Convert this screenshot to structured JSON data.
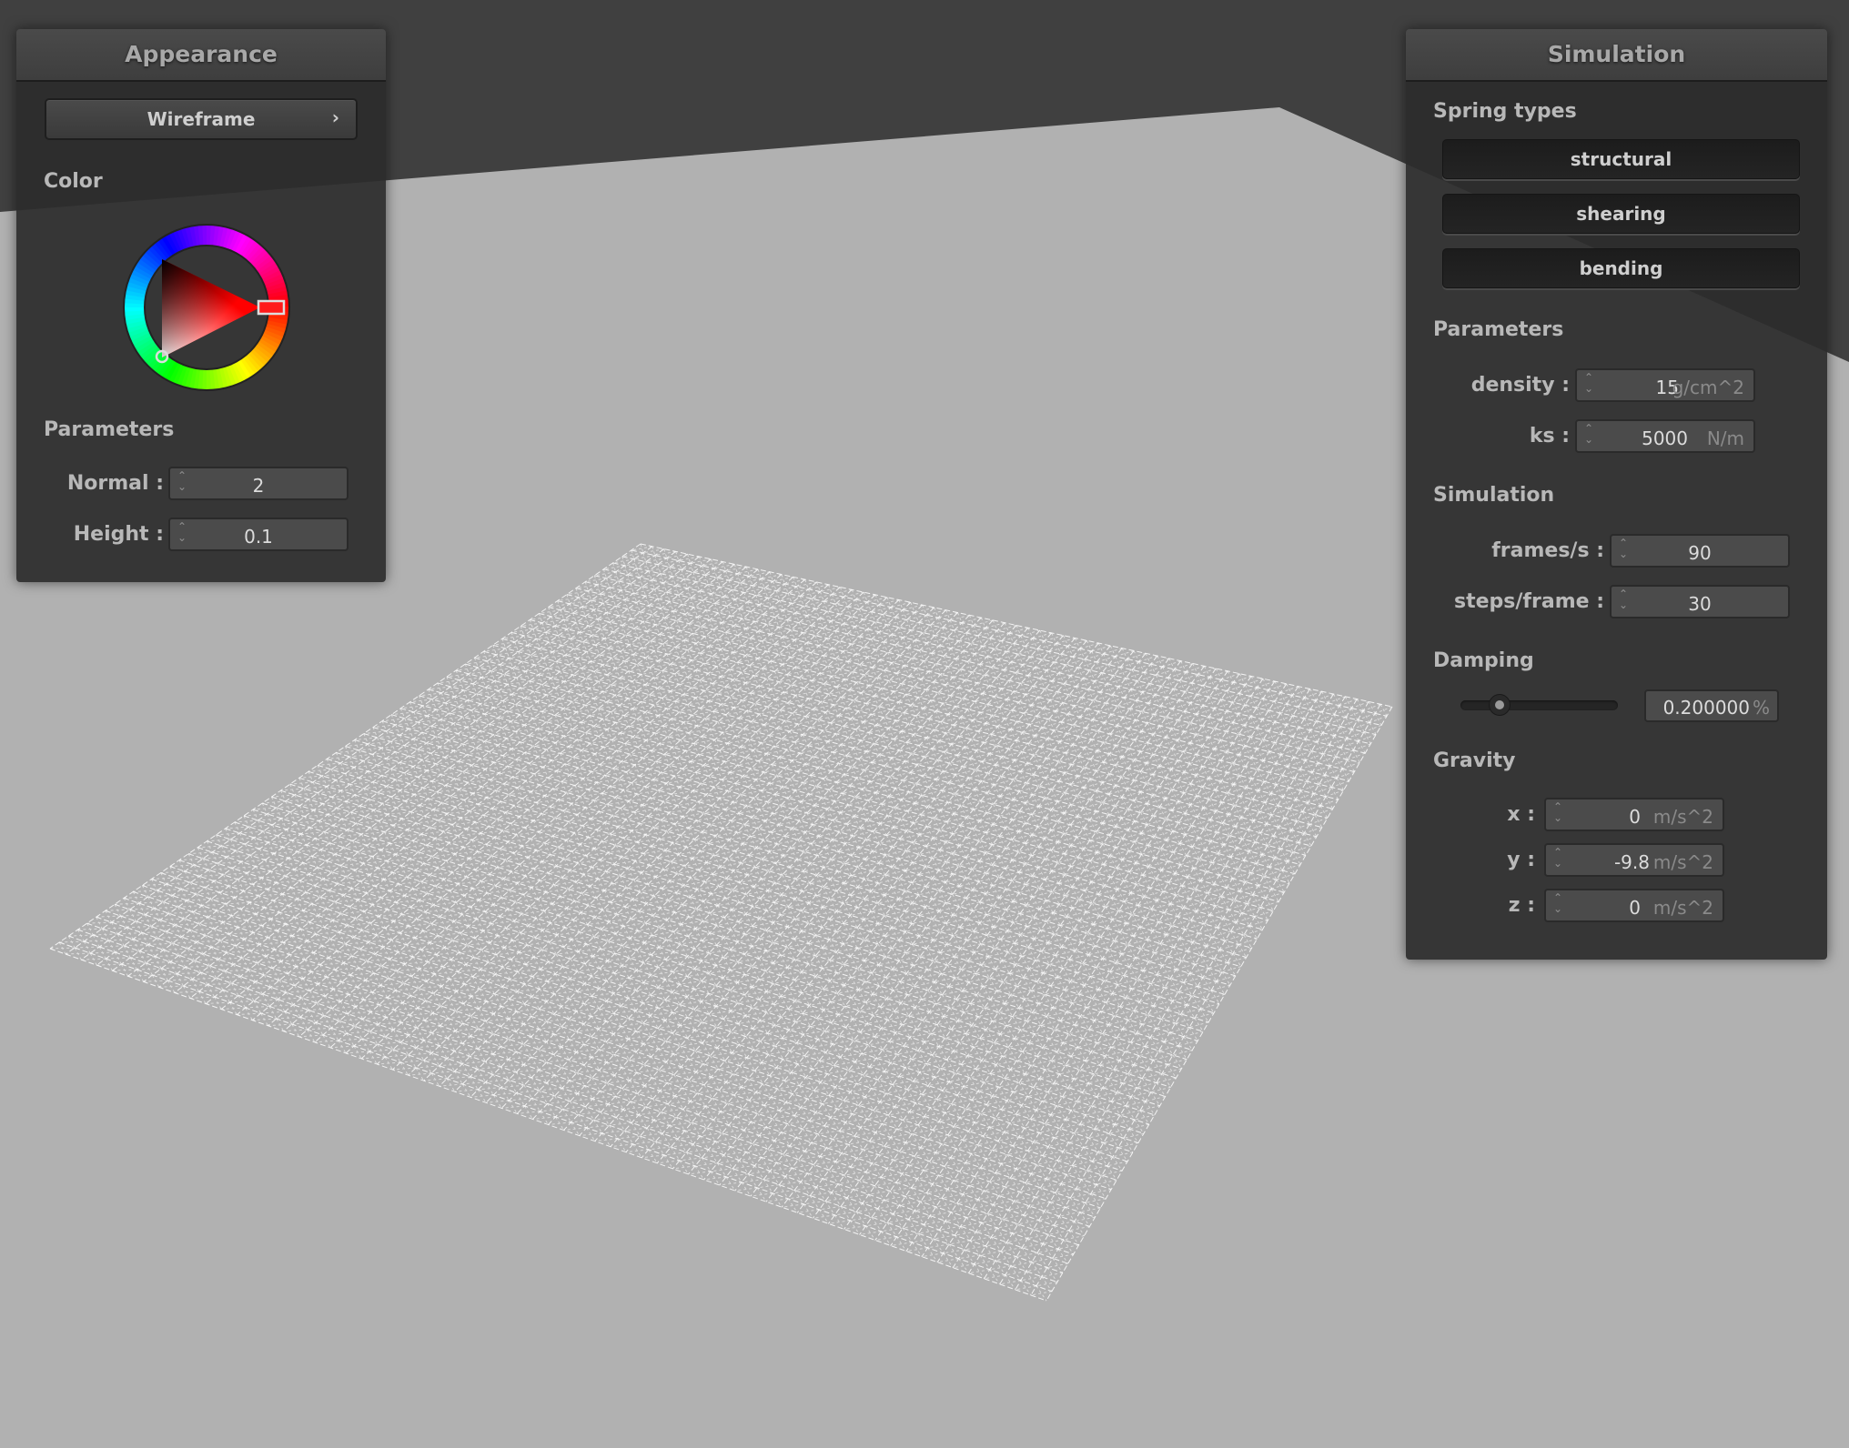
{
  "appearance": {
    "title": "Appearance",
    "mode_button": {
      "label": "Wireframe",
      "chevron": "›"
    },
    "color_section": "Color",
    "color_picker": {
      "hue_deg": 0,
      "selected_color": "#ff0000"
    },
    "parameters_section": "Parameters",
    "fields": [
      {
        "label": "Normal :",
        "value": "2"
      },
      {
        "label": "Height :",
        "value": "0.1"
      }
    ]
  },
  "simulation": {
    "title": "Simulation",
    "spring_types_section": "Spring types",
    "spring_types": [
      "structural",
      "shearing",
      "bending"
    ],
    "parameters_section": "Parameters",
    "parameters": [
      {
        "label": "density :",
        "value": "15",
        "unit": "g/cm^2"
      },
      {
        "label": "ks :",
        "value": "5000",
        "unit": "N/m"
      }
    ],
    "simulation_section": "Simulation",
    "sim_fields": [
      {
        "label": "frames/s :",
        "value": "90"
      },
      {
        "label": "steps/frame :",
        "value": "30"
      }
    ],
    "damping_section": "Damping",
    "damping": {
      "value": "0.200000",
      "unit": "%",
      "slider_fraction": 0.2
    },
    "gravity_section": "Gravity",
    "gravity": [
      {
        "label": "x :",
        "value": "0",
        "unit": "m/s^2"
      },
      {
        "label": "y :",
        "value": "-9.8",
        "unit": "m/s^2"
      },
      {
        "label": "z :",
        "value": "0",
        "unit": "m/s^2"
      }
    ]
  },
  "scene": {
    "background_color": "#404040",
    "floor_color": "#b1b1b1",
    "cloth_color": "#ffffff",
    "cloth_grid_resolution": 64
  },
  "icons": {
    "spin_up": "⌃",
    "spin_down": "⌄"
  }
}
